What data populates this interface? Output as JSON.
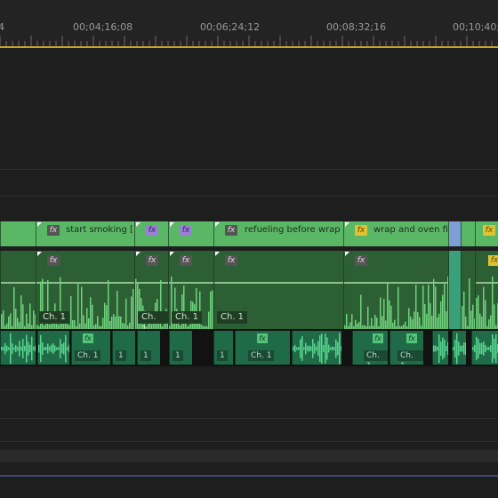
{
  "ruler": {
    "timecodes": [
      "4",
      "00;04;16;08",
      "00;06;24;12",
      "00;08;32;16",
      "00;10;40;"
    ]
  },
  "video_track": {
    "clips": [
      {
        "name": "",
        "fx": ""
      },
      {
        "name": "start smoking [",
        "fx": "gray"
      },
      {
        "name": "",
        "fx": "purple"
      },
      {
        "name": "",
        "fx": "purple"
      },
      {
        "name": "refueling before wrap [",
        "fx": "gray"
      },
      {
        "name": "wrap and oven fi",
        "fx": "yellow"
      },
      {
        "name": "",
        "fx": ""
      },
      {
        "name": "",
        "fx": "yellow"
      }
    ]
  },
  "audio_track_1": {
    "channel_label": "Ch. 1"
  },
  "audio_track_2": {
    "channel_label": "Ch. 1",
    "short_label": "1"
  },
  "icons": {
    "fx_badge": "fx-icon"
  },
  "colors": {
    "video_clip": "#5ab765",
    "audio_clip": "#2d5f34",
    "audio2_clip": "#1f6b47",
    "playhead_bar": "#c9a624"
  }
}
